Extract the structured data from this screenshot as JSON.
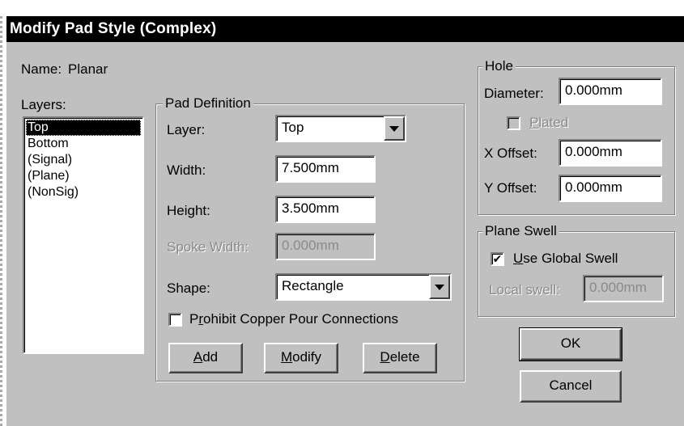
{
  "dialog": {
    "title": "Modify Pad Style (Complex)"
  },
  "name": {
    "label": "Name:",
    "value": "Planar"
  },
  "layers": {
    "label": "Layers:",
    "items": [
      "Top",
      "Bottom",
      "(Signal)",
      "(Plane)",
      "(NonSig)"
    ],
    "selected": "Top"
  },
  "pad_definition": {
    "legend": "Pad Definition",
    "layer_label": "Layer:",
    "layer_value": "Top",
    "width_label": "Width:",
    "width_value": "7.500mm",
    "height_label": "Height:",
    "height_value": "3.500mm",
    "spoke_label": "Spoke Width:",
    "spoke_value": "0.000mm",
    "shape_label": "Shape:",
    "shape_value": "Rectangle",
    "prohibit_label_u": "r",
    "prohibit_label_pre": "P",
    "prohibit_label_post": "ohibit Copper Pour Connections",
    "prohibit_checked": false,
    "add_u": "A",
    "add_rest": "dd",
    "modify_u": "M",
    "modify_rest": "odify",
    "delete_u": "D",
    "delete_rest": "elete"
  },
  "hole": {
    "legend": "Hole",
    "diameter_label": "Diameter:",
    "diameter_value": "0.000mm",
    "plated_u": "P",
    "plated_rest": "lated",
    "plated_checked": false,
    "xoffset_label": "X Offset:",
    "xoffset_value": "0.000mm",
    "yoffset_label": "Y Offset:",
    "yoffset_value": "0.000mm"
  },
  "plane_swell": {
    "legend": "Plane Swell",
    "use_global_u": "U",
    "use_global_rest": "se Global Swell",
    "use_global_checked": true,
    "check_mark": "✔",
    "local_label": "Local swell:",
    "local_value": "0.000mm"
  },
  "buttons": {
    "ok": "OK",
    "cancel": "Cancel"
  }
}
